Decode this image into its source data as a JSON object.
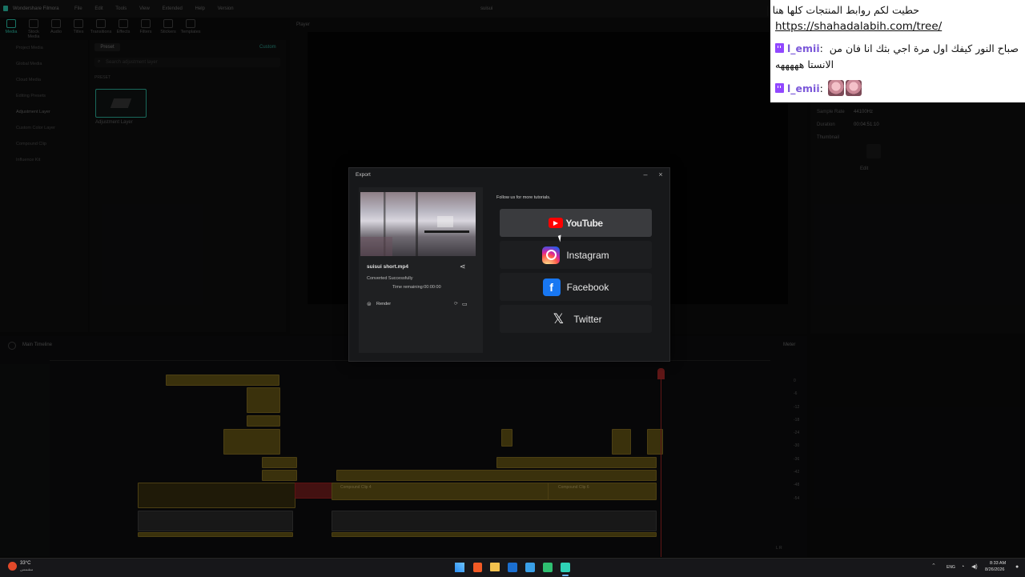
{
  "app": {
    "name": "Wondershare Filmora",
    "menu": [
      "File",
      "Edit",
      "Tools",
      "View",
      "Extended",
      "Help",
      "Version"
    ],
    "project_title": "suisui",
    "tools": [
      "Media",
      "Stock Media",
      "Audio",
      "Titles",
      "Transitions",
      "Effects",
      "Filters",
      "Stickers",
      "Templates"
    ],
    "active_tool": "Media"
  },
  "left_nav": {
    "items": [
      "Project Media",
      "Global Media",
      "Cloud Media",
      "Editing Presets",
      "Adjustment Layer",
      "Custom Color Layer",
      "Compound Clip",
      "Influence Kit"
    ],
    "selected": "Adjustment Layer"
  },
  "library": {
    "tab_preset": "Preset",
    "tab_custom": "Custom",
    "search_placeholder": "Search adjustment layer",
    "section_label": "PRESET",
    "item_label": "Adjustment Layer"
  },
  "player": {
    "label": "Player"
  },
  "inspector": {
    "sample_rate_label": "Sample Rate",
    "sample_rate_value": "44100Hz",
    "duration_label": "Duration",
    "duration_value": "00:04:51:10",
    "thumbnail_label": "Thumbnail",
    "edit_label": "Edit"
  },
  "timeline": {
    "label": "Main Timeline",
    "meter_label": "Meter",
    "meter_scale": [
      "0",
      "-6",
      "-12",
      "-18",
      "-24",
      "-30",
      "-36",
      "-42",
      "-48",
      "-54"
    ],
    "meter_lr": "L R",
    "compound_clip_label": "Compound Clip 4",
    "compound_clip_label_b": "Compound Clip 6"
  },
  "chat": {
    "messages": [
      {
        "user": "",
        "text": "حطيت لكم روابط المنتجات كلها هنا |",
        "link": "https://shahadalabih.com/tree/"
      },
      {
        "user": "l_emii",
        "text_line1": "صباح النور كيفك اول مرة اجي بثك انا فان من",
        "text_line2": "الانستا هههههه"
      },
      {
        "user": "l_emii",
        "emotes": [
          "emote",
          "emote"
        ]
      }
    ]
  },
  "export_dialog": {
    "title": "Export",
    "minimize": "–",
    "close": "×",
    "file_name": "suisui short.mp4",
    "status": "Converted Successfully",
    "time_remaining": "Time remaining:00:00:00",
    "render_label": "Render",
    "follow_text": "Follow us for more tutorials.",
    "social_buttons": [
      {
        "label": "YouTube",
        "icon": "youtube-icon"
      },
      {
        "label": "Instagram",
        "icon": "instagram-icon"
      },
      {
        "label": "Facebook",
        "icon": "facebook-icon"
      },
      {
        "label": "Twitter",
        "icon": "x-twitter-icon"
      }
    ]
  },
  "taskbar": {
    "weather_temp": "33°C",
    "weather_desc": "مشمس",
    "lang": "ENG",
    "time": "8:33 AM",
    "date": "8/26/2026"
  }
}
